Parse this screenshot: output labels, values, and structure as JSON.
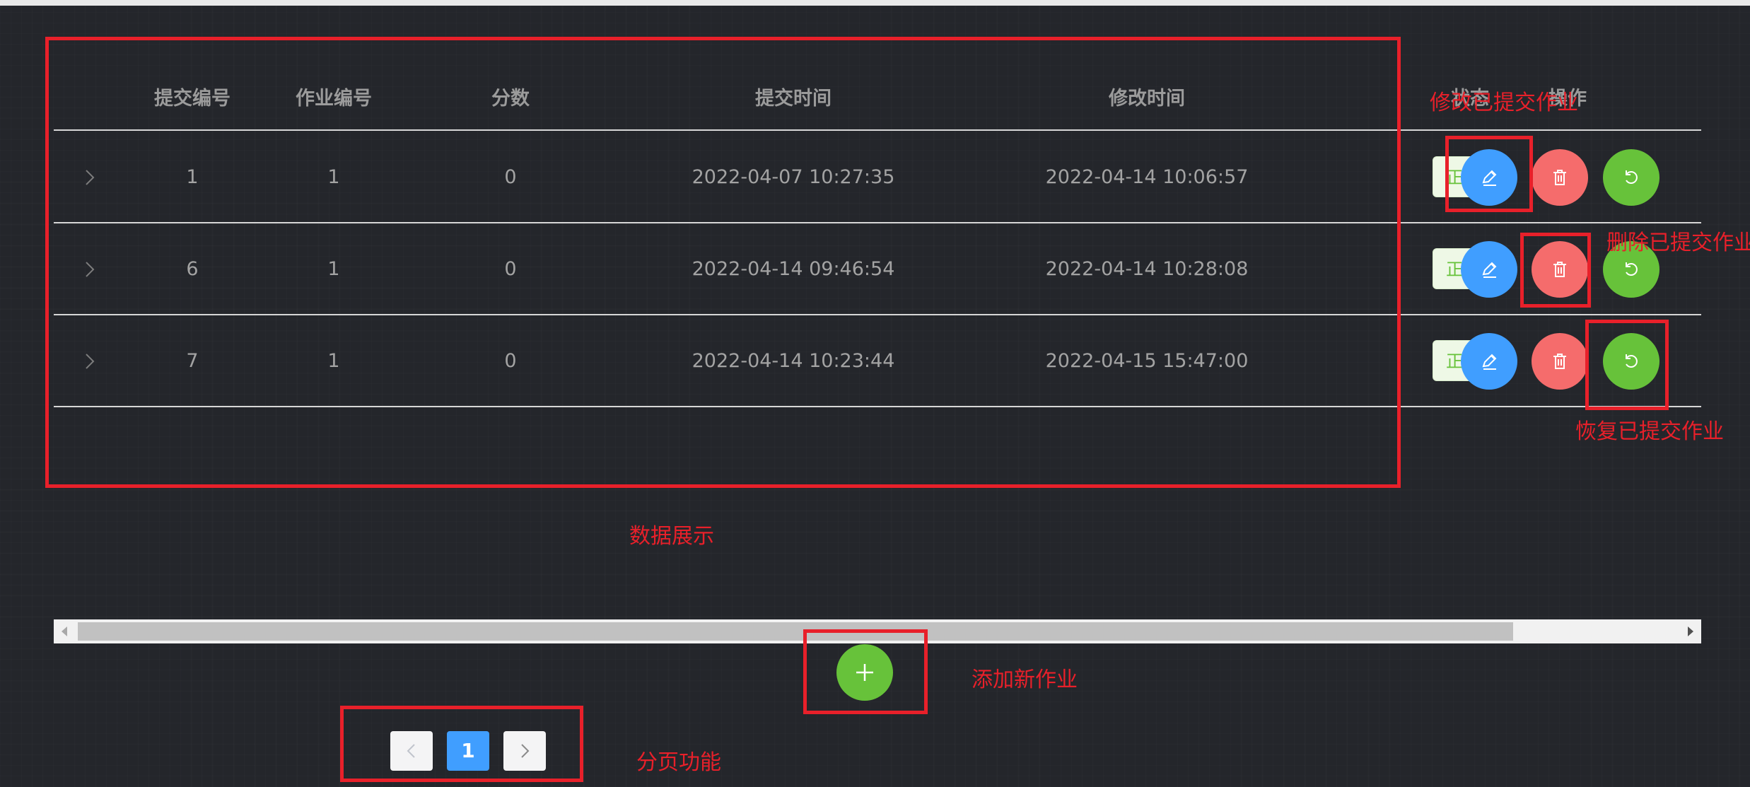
{
  "table": {
    "columns": [
      {
        "key": "submit_id",
        "label": "提交编号"
      },
      {
        "key": "homework_id",
        "label": "作业编号"
      },
      {
        "key": "score",
        "label": "分数"
      },
      {
        "key": "submit_time",
        "label": "提交时间"
      },
      {
        "key": "modify_time",
        "label": "修改时间"
      },
      {
        "key": "status",
        "label": "状态"
      },
      {
        "key": "actions",
        "label": "操作"
      }
    ],
    "rows": [
      {
        "submit_id": "1",
        "homework_id": "1",
        "score": "0",
        "submit_time": "2022-04-07 10:27:35",
        "modify_time": "2022-04-14 10:06:57",
        "status": "正"
      },
      {
        "submit_id": "6",
        "homework_id": "1",
        "score": "0",
        "submit_time": "2022-04-14 09:46:54",
        "modify_time": "2022-04-14 10:28:08",
        "status": "正"
      },
      {
        "submit_id": "7",
        "homework_id": "1",
        "score": "0",
        "submit_time": "2022-04-14 10:23:44",
        "modify_time": "2022-04-15 15:47:00",
        "status": "正"
      }
    ]
  },
  "annotations": {
    "edit": "修改已提交作业",
    "delete": "删除已提交作业",
    "restore": "恢复已提交作业",
    "data_display": "数据展示",
    "add_new": "添加新作业",
    "pagination": "分页功能"
  },
  "pagination": {
    "current_page": "1"
  },
  "colors": {
    "primary": "#409eff",
    "danger": "#f56c6c",
    "success": "#67c23a",
    "annotation": "#e8202a",
    "background": "#24262b"
  },
  "icons": {
    "expand": "chevron-right-icon",
    "edit": "pencil-icon",
    "delete": "trash-icon",
    "restore": "refresh-icon",
    "add": "plus-icon",
    "prev": "chevron-left-icon",
    "next": "chevron-right-icon"
  }
}
